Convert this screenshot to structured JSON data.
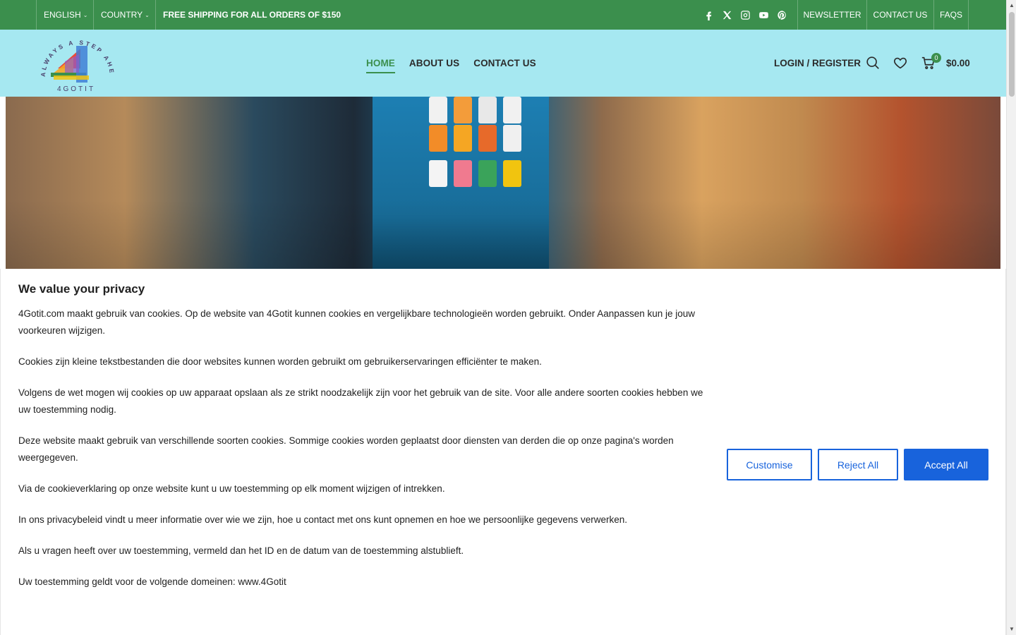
{
  "topbar": {
    "language": "ENGLISH",
    "country": "COUNTRY",
    "promo": "FREE SHIPPING FOR ALL ORDERS OF $150",
    "social_icons": [
      "facebook-icon",
      "x-icon",
      "instagram-icon",
      "youtube-icon",
      "pinterest-icon"
    ],
    "links": [
      "NEWSLETTER",
      "CONTACT US",
      "FAQS"
    ]
  },
  "header": {
    "logo_top_text": "ALWAYS A STEP AHEAD",
    "logo_brand": "4GOTIT",
    "nav": [
      "HOME",
      "ABOUT US",
      "CONTACT US"
    ],
    "active_nav": "HOME",
    "login": "LOGIN / REGISTER",
    "cart_count": "0",
    "cart_total": "$0.00"
  },
  "cookie": {
    "title": "We value your privacy",
    "paragraphs": [
      "4Gotit.com maakt gebruik van cookies. Op de website van 4Gotit kunnen cookies en vergelijkbare technologieën worden gebruikt. Onder Aanpassen kun je jouw voorkeuren wijzigen.",
      "Cookies zijn kleine tekstbestanden die door websites kunnen worden gebruikt om gebruikerservaringen efficiënter te maken.",
      "Volgens de wet mogen wij cookies op uw apparaat opslaan als ze strikt noodzakelijk zijn voor het gebruik van de site. Voor alle andere soorten cookies hebben we uw toestemming nodig.",
      "Deze website maakt gebruik van verschillende soorten cookies. Sommige cookies worden geplaatst door diensten van derden die op onze pagina's worden weergegeven.",
      "Via de cookieverklaring op onze website kunt u uw toestemming op elk moment wijzigen of intrekken.",
      "In ons privacybeleid vindt u meer informatie over wie we zijn, hoe u contact met ons kunt opnemen en hoe we persoonlijke gegevens verwerken.",
      "Als u vragen heeft over uw toestemming, vermeld dan het ID en de datum van de toestemming alstublieft.",
      "Uw toestemming geldt voor de volgende domeinen: www.4Gotit"
    ],
    "buttons": {
      "customise": "Customise",
      "reject": "Reject All",
      "accept": "Accept All"
    }
  },
  "colors": {
    "topbar": "#3b8f4d",
    "header": "#a6e8f1",
    "accent": "#1863dc"
  }
}
